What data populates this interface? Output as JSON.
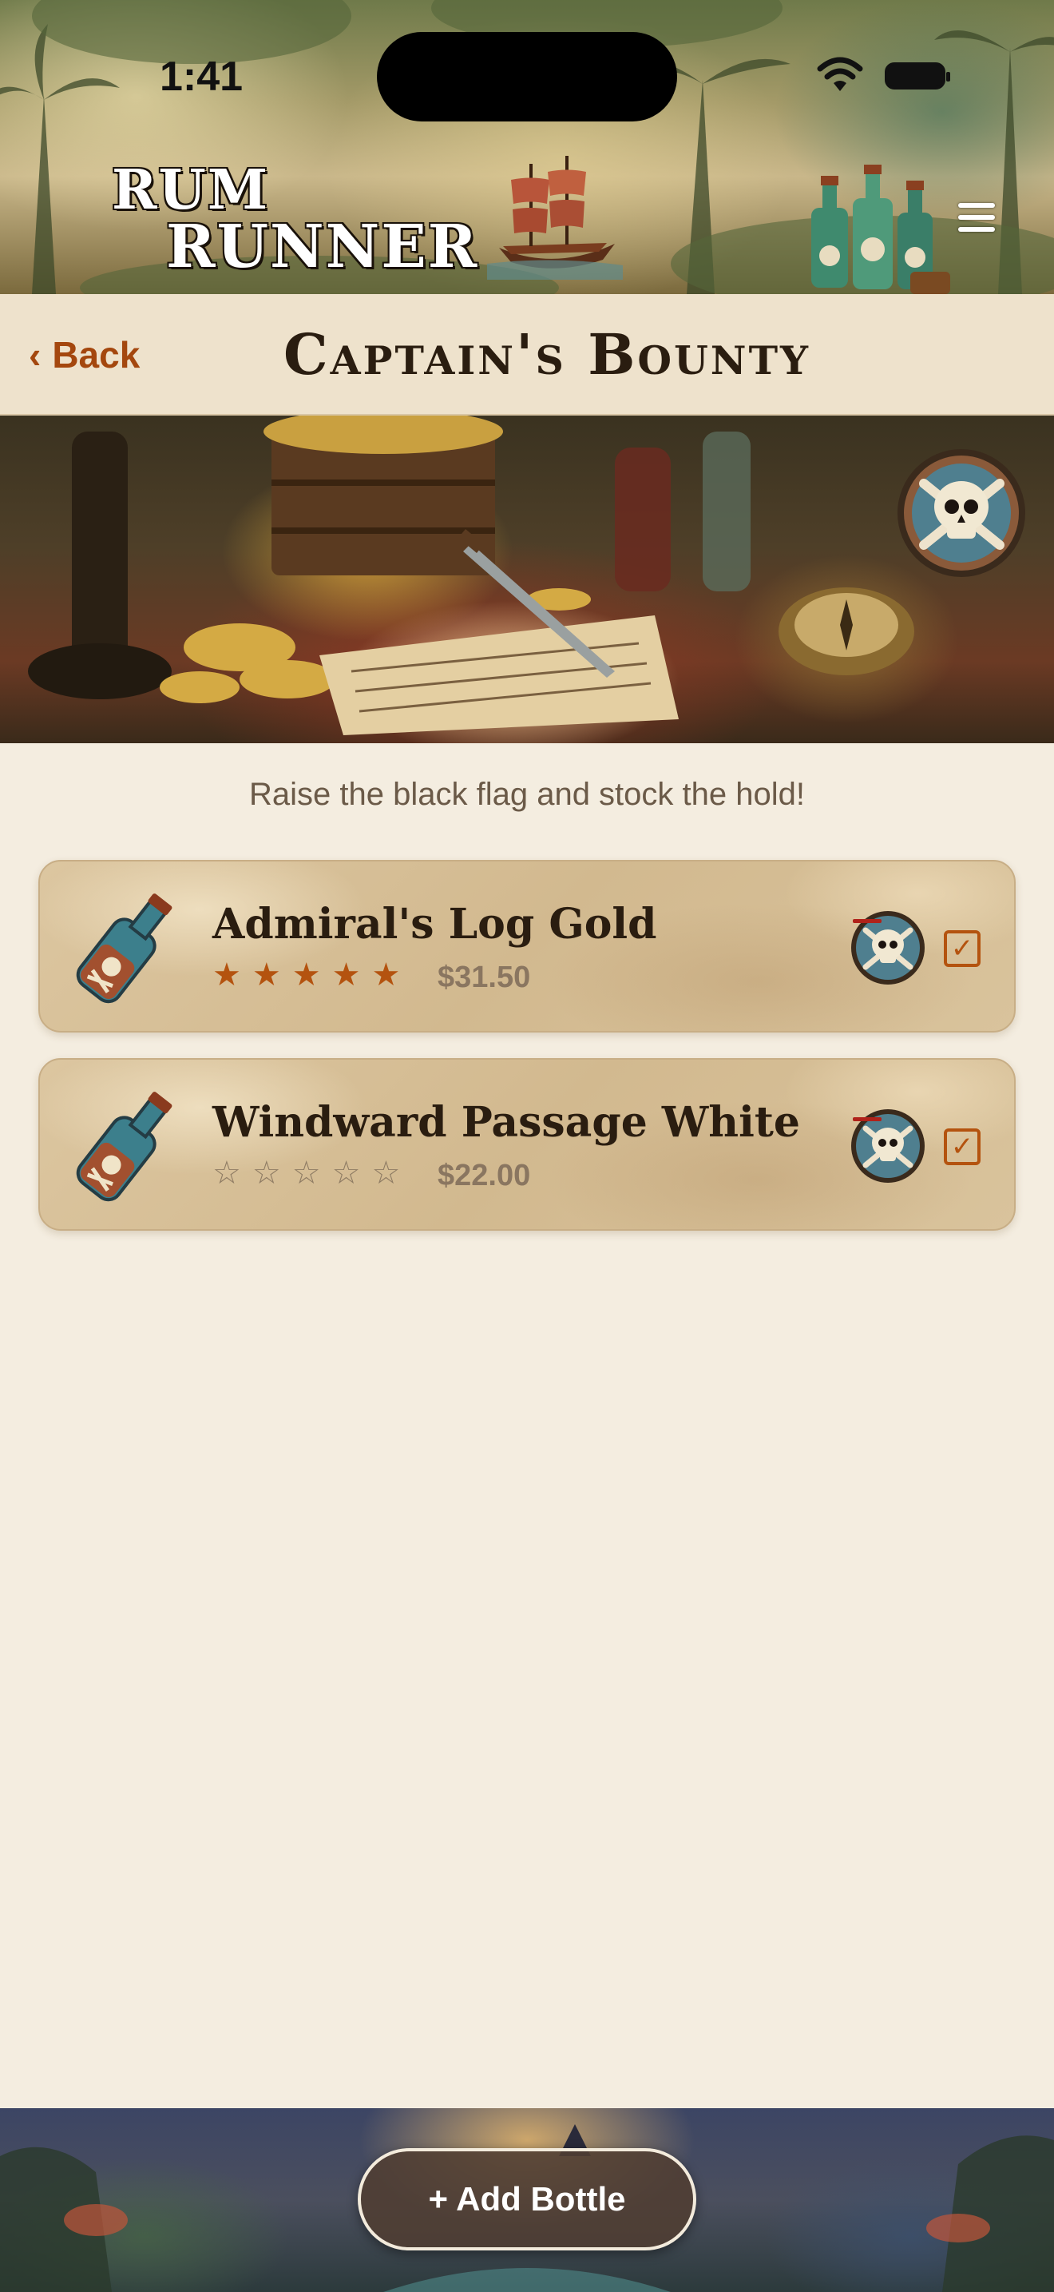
{
  "status_bar": {
    "time": "1:41"
  },
  "header": {
    "logo_line1": "RUM",
    "logo_line2": "RUNNER",
    "menu_icon": "hamburger-menu-icon"
  },
  "titlebar": {
    "back_chevron": "‹",
    "back_label": "Back",
    "title": "Captain's Bounty"
  },
  "tagline": "Raise the black flag and stock the hold!",
  "items": [
    {
      "name": "Admiral's Log Gold",
      "rating": 5,
      "stars": [
        "★",
        "★",
        "★",
        "★",
        "★"
      ],
      "price": "$31.50",
      "checked": true,
      "check_glyph": "✓"
    },
    {
      "name": "Windward Passage White",
      "rating": 0,
      "stars": [
        "☆",
        "☆",
        "☆",
        "☆",
        "☆"
      ],
      "price": "$22.00",
      "checked": true,
      "check_glyph": "✓"
    }
  ],
  "footer": {
    "add_button_label": "+ Add Bottle"
  },
  "colors": {
    "accent": "#b4530f",
    "background": "#f4ede0",
    "titlebar": "#eee2cc",
    "text_dark": "#2a1d10",
    "text_muted": "#6b5a48"
  }
}
